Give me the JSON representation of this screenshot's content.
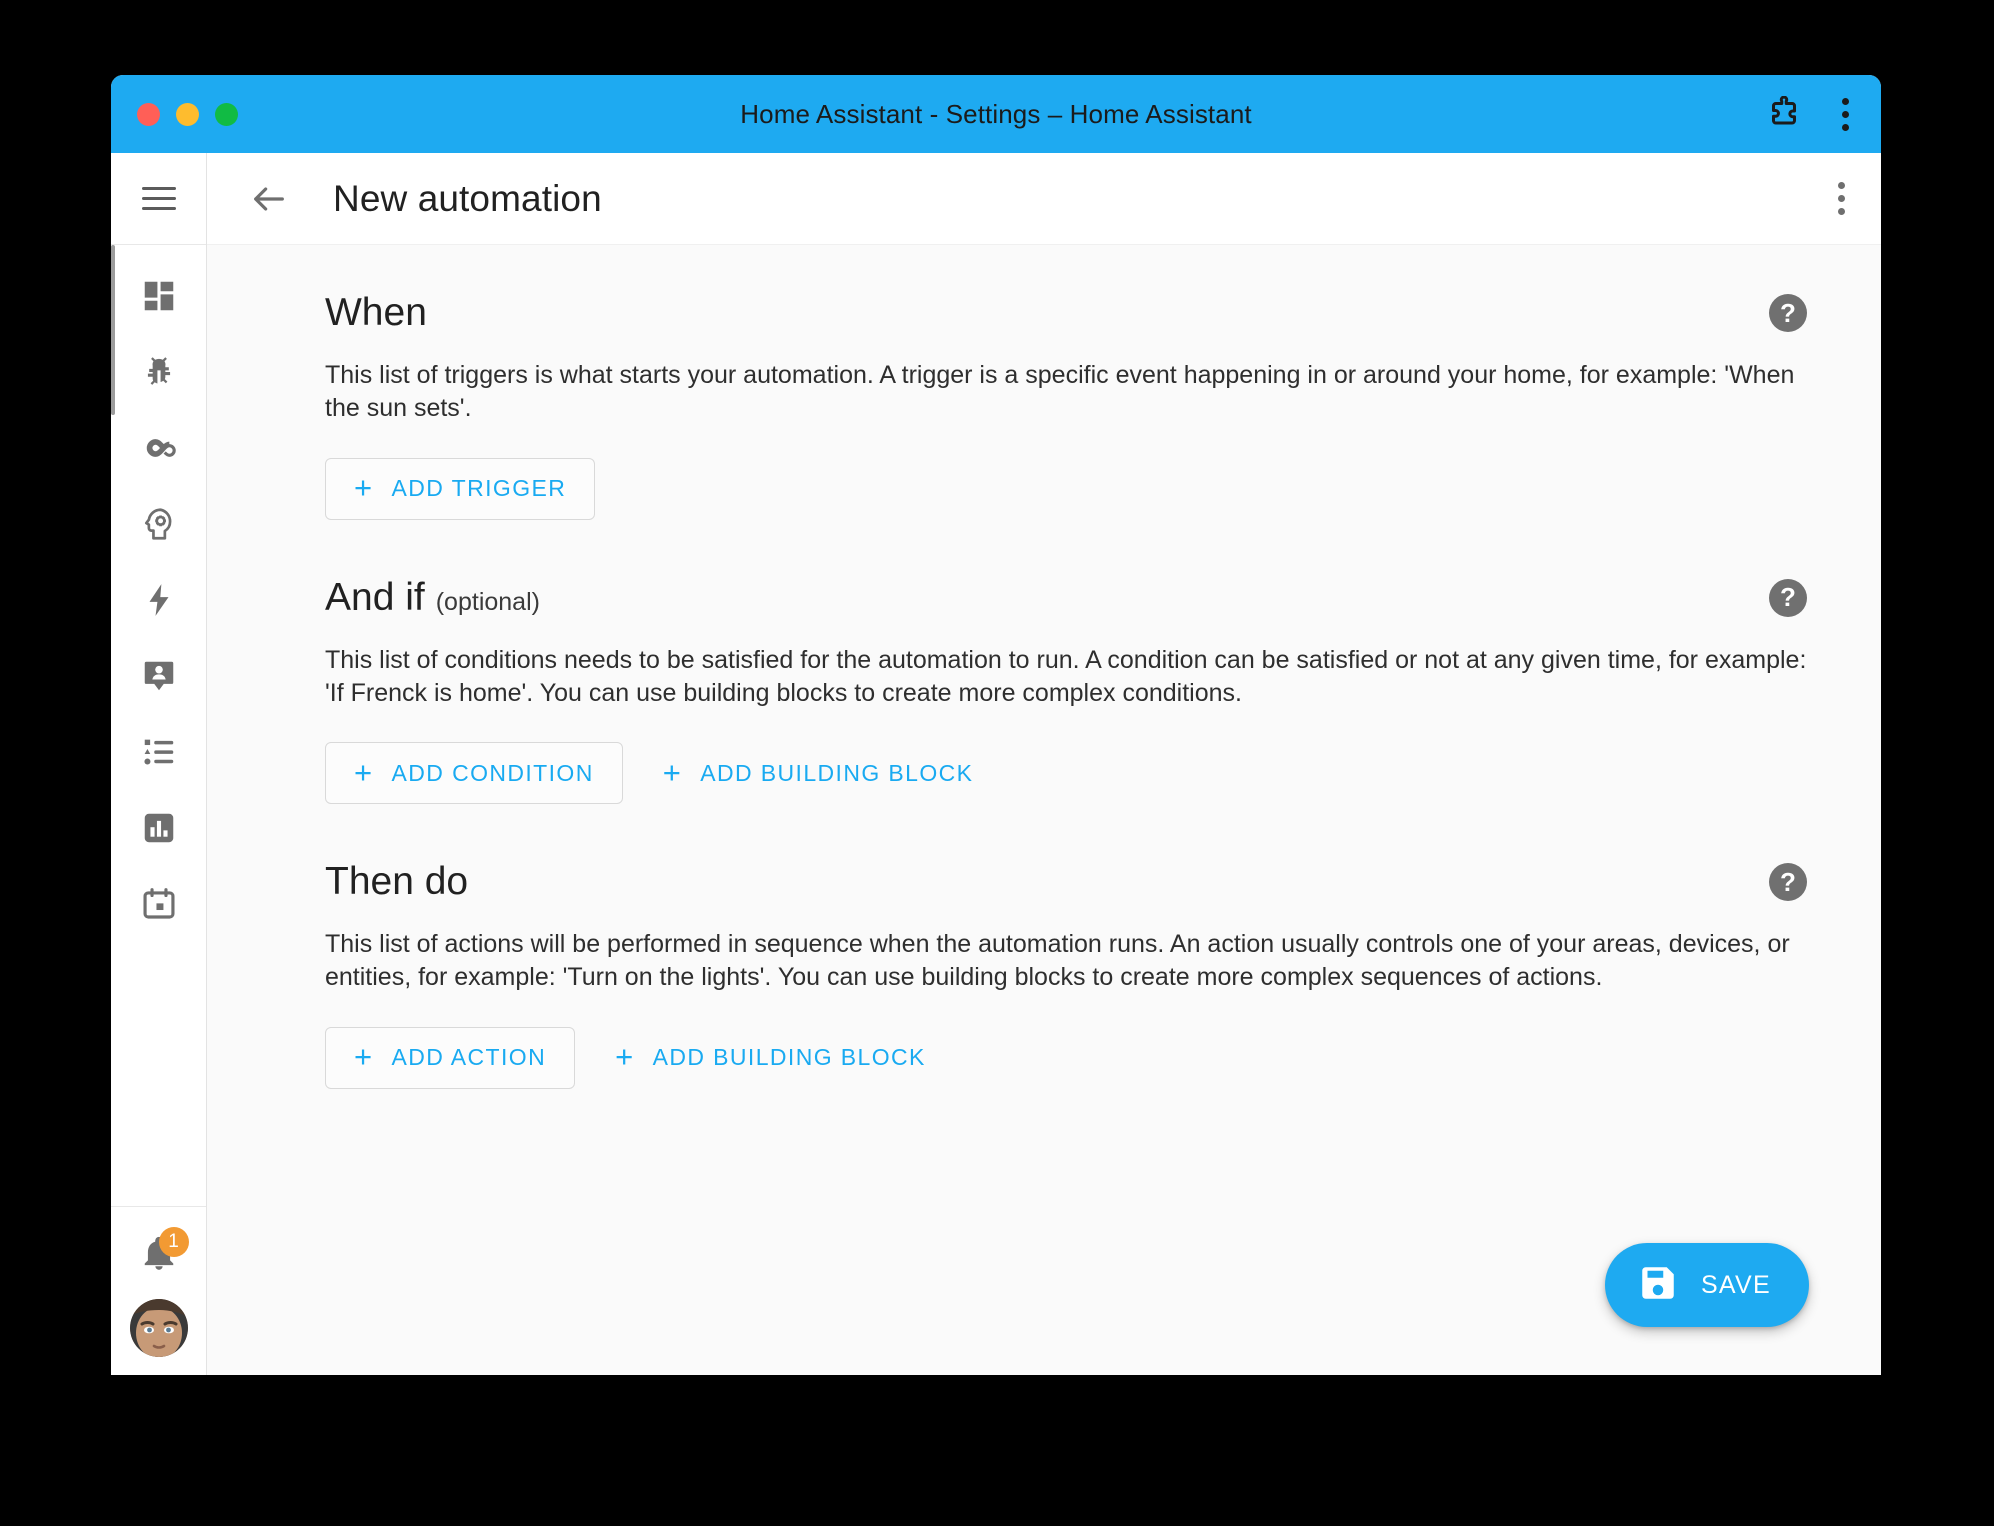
{
  "window": {
    "title": "Home Assistant - Settings – Home Assistant",
    "traffic_lights": [
      "close",
      "minimize",
      "maximize"
    ],
    "colors": {
      "titlebar": "#1eaaf1",
      "accent": "#19aaf1",
      "badge": "#f29a33",
      "help_circle": "#707070"
    },
    "actions": [
      {
        "name": "extensions-icon",
        "label": "Extensions"
      },
      {
        "name": "browser-menu-icon",
        "label": "More options"
      }
    ]
  },
  "sidebar": {
    "menu_button": "hamburger-menu",
    "items": [
      {
        "name": "sidebar-item-overview",
        "icon": "view-dashboard-icon"
      },
      {
        "name": "sidebar-item-developer-tools",
        "icon": "bug-icon"
      },
      {
        "name": "sidebar-item-automations",
        "icon": "infinity-icon"
      },
      {
        "name": "sidebar-item-settings",
        "icon": "head-cog-icon"
      },
      {
        "name": "sidebar-item-energy",
        "icon": "lightning-bolt-icon"
      },
      {
        "name": "sidebar-item-map",
        "icon": "map-marker-account-icon"
      },
      {
        "name": "sidebar-item-logbook",
        "icon": "format-list-bulleted-icon"
      },
      {
        "name": "sidebar-item-history",
        "icon": "chart-box-icon"
      },
      {
        "name": "sidebar-item-calendar",
        "icon": "calendar-icon"
      }
    ],
    "notifications": {
      "icon": "bell-icon",
      "count": "1"
    },
    "user": {
      "name": "user-avatar"
    }
  },
  "toolbar": {
    "back": "back-arrow-icon",
    "title": "New automation",
    "overflow": "overflow-menu-icon"
  },
  "sections": [
    {
      "id": "when",
      "title": "When",
      "optional_suffix": "",
      "description": "This list of triggers is what starts your automation. A trigger is a specific event happening in or around your home, for example: 'When the sun sets'.",
      "help": "?",
      "buttons": [
        {
          "name": "add-trigger-button",
          "label": "ADD TRIGGER",
          "style": "outlined",
          "plus": "+"
        }
      ]
    },
    {
      "id": "and-if",
      "title": "And if",
      "optional_suffix": "(optional)",
      "description": "This list of conditions needs to be satisfied for the automation to run. A condition can be satisfied or not at any given time, for example: 'If Frenck is home'. You can use building blocks to create more complex conditions.",
      "help": "?",
      "buttons": [
        {
          "name": "add-condition-button",
          "label": "ADD CONDITION",
          "style": "outlined",
          "plus": "+"
        },
        {
          "name": "add-building-block-button-condition",
          "label": "ADD BUILDING BLOCK",
          "style": "text",
          "plus": "+"
        }
      ]
    },
    {
      "id": "then-do",
      "title": "Then do",
      "optional_suffix": "",
      "description": "This list of actions will be performed in sequence when the automation runs. An action usually controls one of your areas, devices, or entities, for example: 'Turn on the lights'. You can use building blocks to create more complex sequences of actions.",
      "help": "?",
      "buttons": [
        {
          "name": "add-action-button",
          "label": "ADD ACTION",
          "style": "outlined",
          "plus": "+"
        },
        {
          "name": "add-building-block-button-action",
          "label": "ADD BUILDING BLOCK",
          "style": "text",
          "plus": "+"
        }
      ]
    }
  ],
  "fab": {
    "name": "save-button",
    "label": "SAVE",
    "icon": "content-save-icon"
  }
}
